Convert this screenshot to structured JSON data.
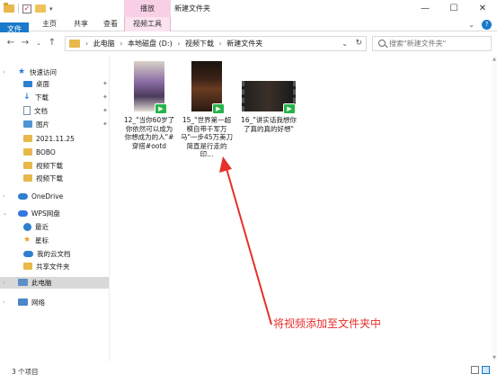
{
  "window": {
    "title": "新建文件夹",
    "context_tab_header": "播放"
  },
  "ribbon": {
    "tabs": [
      "文件",
      "主页",
      "共享",
      "查看",
      "视频工具"
    ]
  },
  "address": {
    "crumbs": [
      "此电脑",
      "本地磁盘 (D:)",
      "视频下载",
      "新建文件夹"
    ],
    "search_placeholder": "搜索\"新建文件夹\""
  },
  "sidebar": {
    "items": [
      {
        "label": "快速访问",
        "icon": "star-icon"
      },
      {
        "label": "桌面",
        "icon": "desktop-icon",
        "pinned": true
      },
      {
        "label": "下载",
        "icon": "download-icon",
        "pinned": true
      },
      {
        "label": "文档",
        "icon": "document-icon",
        "pinned": true
      },
      {
        "label": "图片",
        "icon": "pictures-icon",
        "pinned": true
      },
      {
        "label": "2021.11.25",
        "icon": "folder-icon"
      },
      {
        "label": "BOBO",
        "icon": "folder-icon"
      },
      {
        "label": "视频下载",
        "icon": "folder-icon"
      },
      {
        "label": "视频下载",
        "icon": "folder-icon"
      },
      {
        "label": "OneDrive",
        "icon": "cloud-icon"
      },
      {
        "label": "WPS网盘",
        "icon": "wps-cloud-icon"
      },
      {
        "label": "最近",
        "icon": "clock-icon"
      },
      {
        "label": "星标",
        "icon": "star-badge-icon"
      },
      {
        "label": "我的云文档",
        "icon": "cloud-doc-icon"
      },
      {
        "label": "共享文件夹",
        "icon": "shared-folder-icon"
      },
      {
        "label": "此电脑",
        "icon": "computer-icon",
        "selected": true
      },
      {
        "label": "网络",
        "icon": "network-icon"
      }
    ]
  },
  "files": [
    {
      "name": "12_\"当你60岁了你依然可以成为你想成为的人\"#穿搭#ootd"
    },
    {
      "name": "15_\"世界第一超模自带千军万马\"一步45万美刀简直是行走的印..."
    },
    {
      "name": "16_\"讲实话我想你了真的真的好想\""
    }
  ],
  "annotation": {
    "text": "将视频添加至文件夹中",
    "color": "#e6302a"
  },
  "status": {
    "item_count": "3 个项目"
  },
  "colors": {
    "accent": "#1979ca",
    "context_tab": "#f8d0e6",
    "video_badge": "#27b34a"
  }
}
